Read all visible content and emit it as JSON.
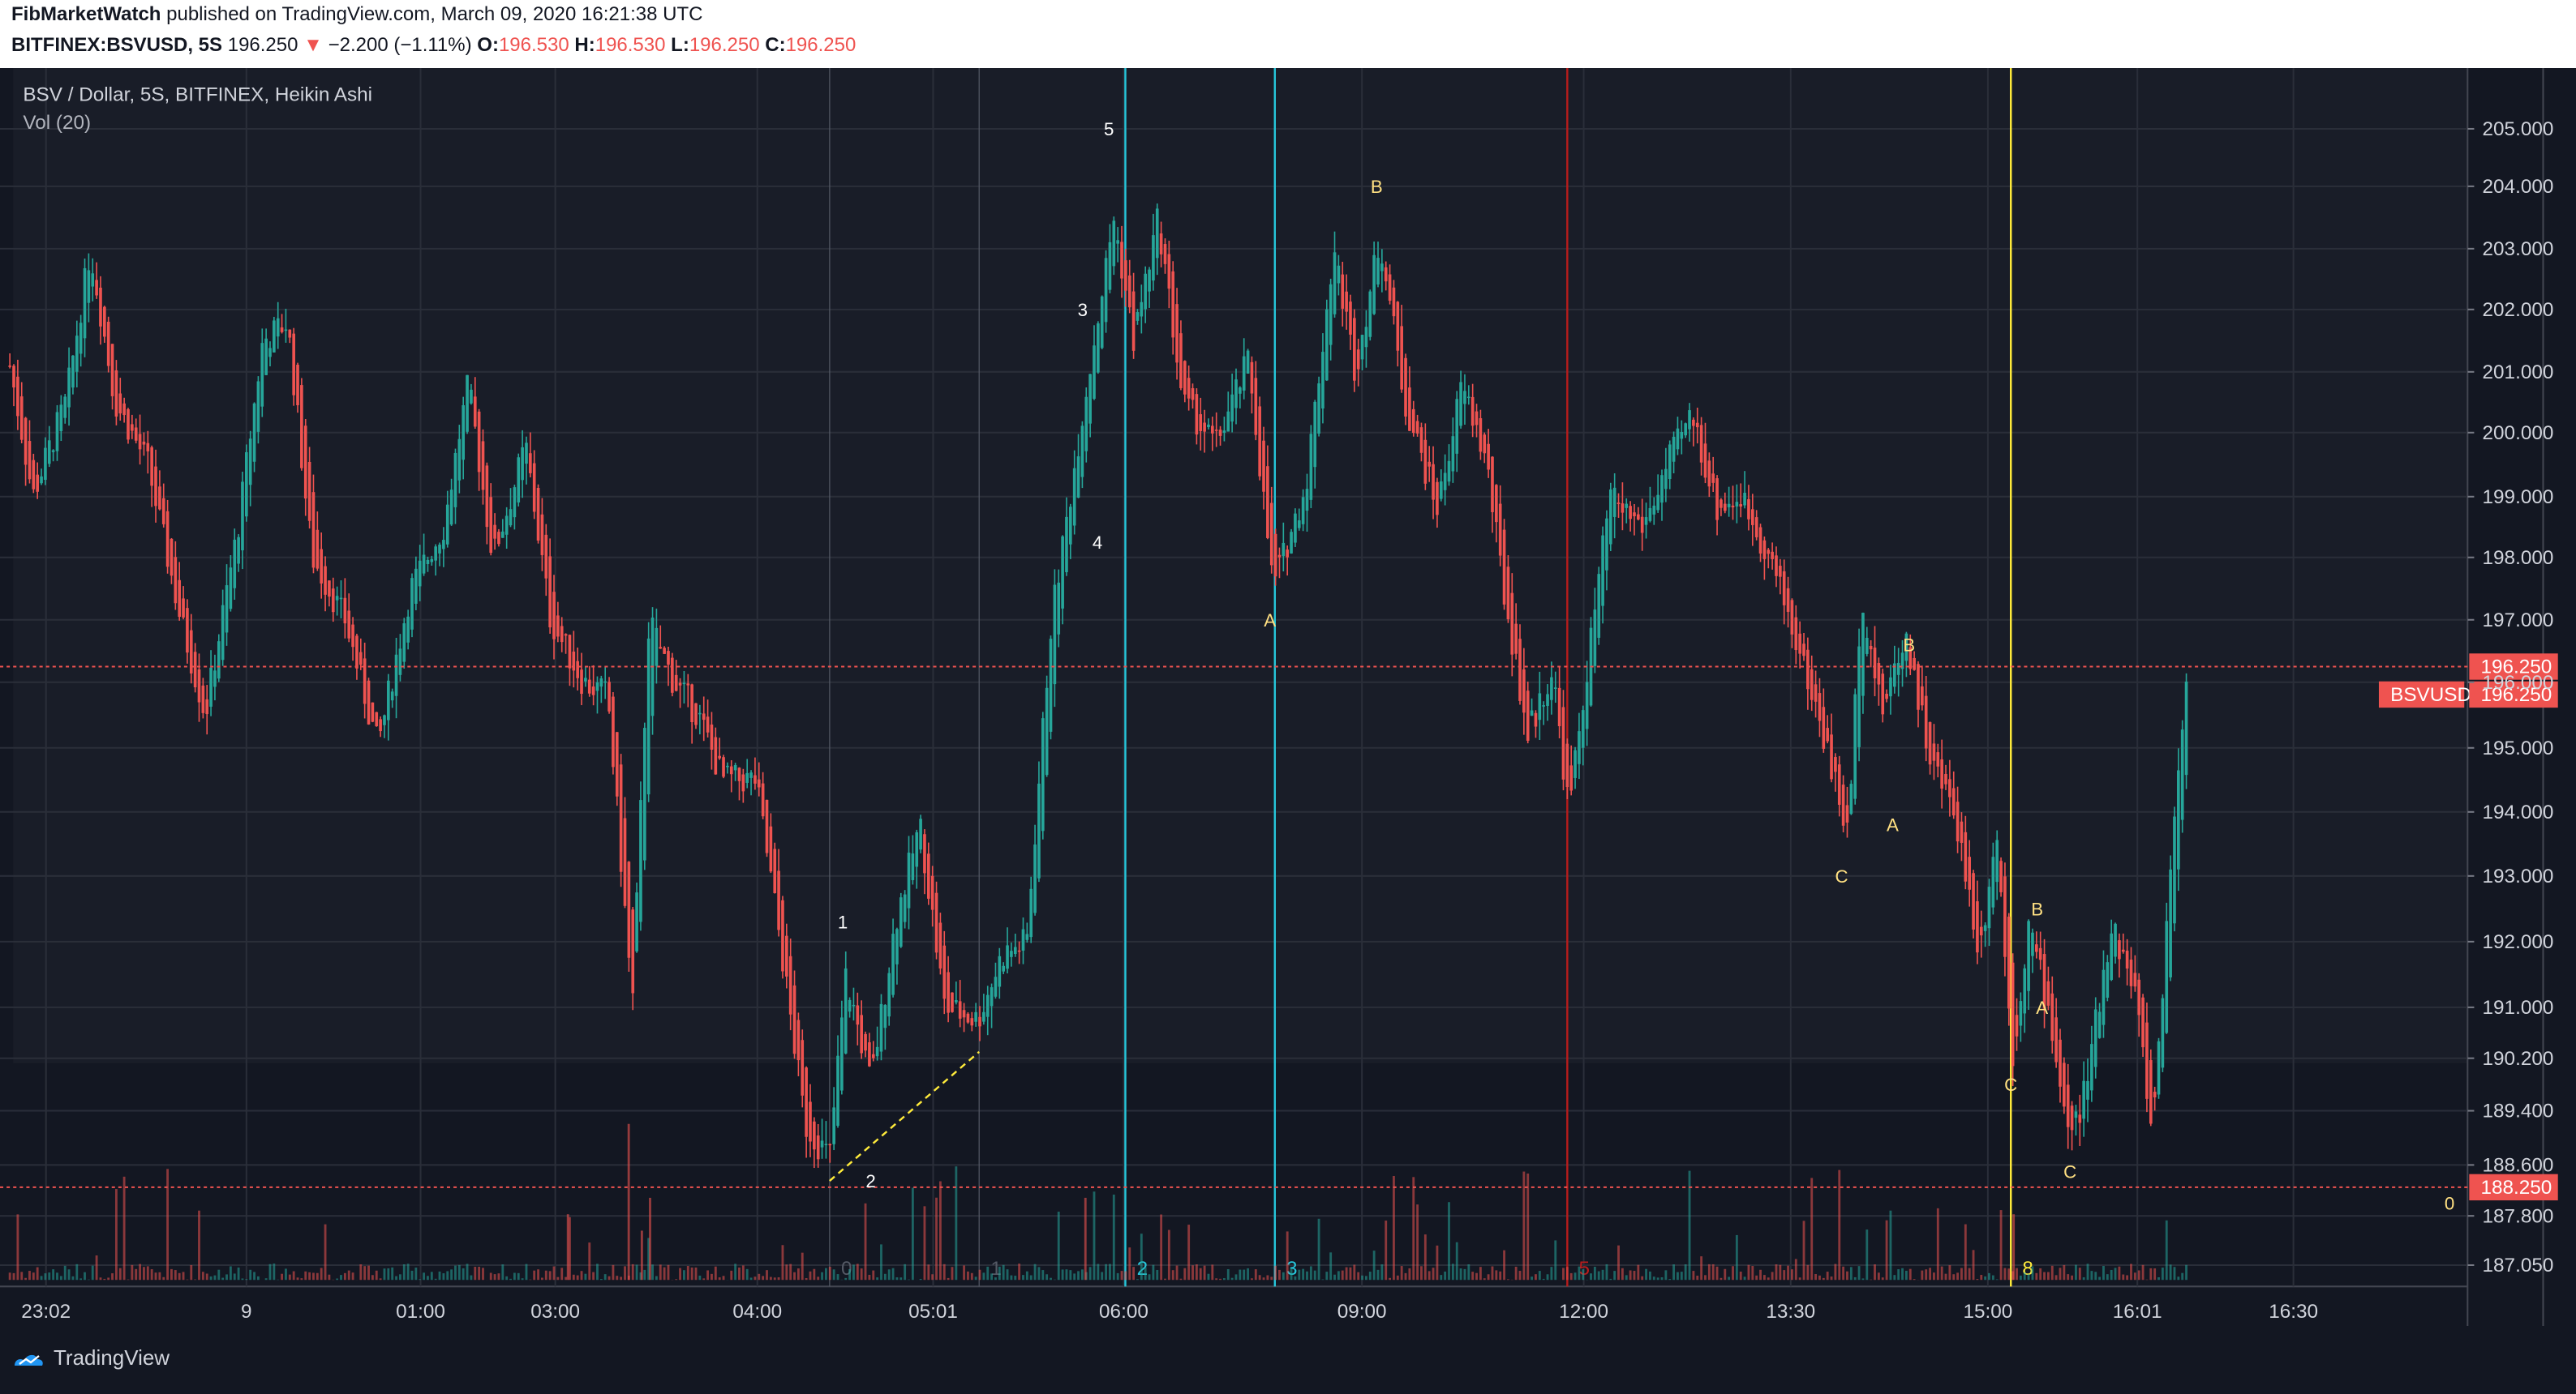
{
  "header": {
    "author": "FibMarketWatch",
    "published": "published on TradingView.com, March 09, 2020 16:21:38 UTC",
    "symbol": "BITFINEX:BSVUSD, 5S",
    "last": "196.250",
    "change": "−2.200 (−1.11%)",
    "o_label": "O:",
    "o_val": "196.530",
    "h_label": "H:",
    "h_val": "196.530",
    "l_label": "L:",
    "l_val": "196.250",
    "c_label": "C:",
    "c_val": "196.250"
  },
  "legend": {
    "title": "BSV / Dollar, 5S, BITFINEX, Heikin Ashi",
    "volume": "Vol (20)"
  },
  "footer": {
    "brand": "TradingView"
  },
  "colors": {
    "background": "#131722",
    "up": "#26a69a",
    "down": "#ef5350",
    "cyan_line": "#26c6da",
    "red_line": "#b71c1c",
    "yellow_line": "#ffeb3b",
    "wave_label": "#ffe082",
    "price_tag": "#ef5350"
  },
  "chart_data": {
    "type": "candlestick",
    "title": "BSV / Dollar, 5S, BITFINEX, Heikin Ashi",
    "ylim": [
      186.8,
      205.6
    ],
    "y_ticks": [
      "205.000",
      "204.000",
      "203.000",
      "202.000",
      "201.000",
      "200.000",
      "199.000",
      "198.000",
      "197.000",
      "196.000",
      "195.000",
      "194.000",
      "193.000",
      "192.000",
      "191.000",
      "190.200",
      "189.400",
      "188.600",
      "187.800",
      "187.050"
    ],
    "x_ticks": [
      "23:02",
      "9",
      "01:00",
      "03:00",
      "04:00",
      "05:01",
      "06:00",
      "09:00",
      "12:00",
      "13:30",
      "15:00",
      "16:01",
      "16:30"
    ],
    "price_path": [
      [
        0,
        202.0
      ],
      [
        20,
        199.0
      ],
      [
        40,
        200.5
      ],
      [
        55,
        203.0
      ],
      [
        70,
        200.5
      ],
      [
        90,
        199.5
      ],
      [
        110,
        197.0
      ],
      [
        125,
        195.5
      ],
      [
        145,
        198.5
      ],
      [
        160,
        201.5
      ],
      [
        175,
        201.8
      ],
      [
        190,
        198.0
      ],
      [
        210,
        197.0
      ],
      [
        230,
        195.0
      ],
      [
        250,
        197.5
      ],
      [
        270,
        198.5
      ],
      [
        285,
        200.8
      ],
      [
        300,
        198.0
      ],
      [
        320,
        199.8
      ],
      [
        335,
        197.0
      ],
      [
        355,
        196.0
      ],
      [
        370,
        195.8
      ],
      [
        385,
        191.0
      ],
      [
        395,
        197.0
      ],
      [
        410,
        196.0
      ],
      [
        425,
        195.5
      ],
      [
        440,
        194.5
      ],
      [
        460,
        194.5
      ],
      [
        475,
        192.0
      ],
      [
        490,
        189.2
      ],
      [
        505,
        188.7
      ],
      [
        515,
        191.5
      ],
      [
        530,
        189.8
      ],
      [
        545,
        192.3
      ],
      [
        560,
        193.8
      ],
      [
        575,
        191.0
      ],
      [
        595,
        190.8
      ],
      [
        610,
        191.8
      ],
      [
        625,
        192.0
      ],
      [
        640,
        197.0
      ],
      [
        660,
        200.5
      ],
      [
        678,
        203.5
      ],
      [
        690,
        201.5
      ],
      [
        705,
        203.5
      ],
      [
        720,
        200.5
      ],
      [
        740,
        199.8
      ],
      [
        760,
        201.2
      ],
      [
        775,
        197.5
      ],
      [
        795,
        199.2
      ],
      [
        812,
        203.0
      ],
      [
        825,
        201.0
      ],
      [
        840,
        203.2
      ],
      [
        855,
        200.5
      ],
      [
        875,
        198.8
      ],
      [
        890,
        200.8
      ],
      [
        905,
        199.5
      ],
      [
        915,
        197.5
      ],
      [
        930,
        195.2
      ],
      [
        945,
        196.2
      ],
      [
        955,
        194.0
      ],
      [
        965,
        196.0
      ],
      [
        980,
        199.0
      ],
      [
        1000,
        198.5
      ],
      [
        1015,
        199.5
      ],
      [
        1030,
        200.3
      ],
      [
        1045,
        198.8
      ],
      [
        1060,
        199.0
      ],
      [
        1080,
        197.8
      ],
      [
        1095,
        196.5
      ],
      [
        1110,
        195.2
      ],
      [
        1125,
        193.6
      ],
      [
        1133,
        197.5
      ],
      [
        1145,
        195.5
      ],
      [
        1160,
        196.8
      ],
      [
        1175,
        194.8
      ],
      [
        1190,
        194.0
      ],
      [
        1205,
        191.8
      ],
      [
        1215,
        193.8
      ],
      [
        1225,
        190.2
      ],
      [
        1235,
        192.3
      ],
      [
        1248,
        190.8
      ],
      [
        1260,
        188.9
      ],
      [
        1270,
        189.8
      ],
      [
        1285,
        192.3
      ],
      [
        1300,
        191.2
      ],
      [
        1310,
        189.0
      ],
      [
        1325,
        194.5
      ],
      [
        1332,
        196.3
      ]
    ],
    "markers": {
      "vertical_lines": [
        {
          "color": "cyan",
          "label": "2",
          "price_label_x": 685
        },
        {
          "color": "cyan",
          "label": "3",
          "price_label_x": 776
        },
        {
          "color": "red",
          "label": "5",
          "price_label_x": 954
        },
        {
          "color": "yellow",
          "label": "8",
          "price_label_x": 1224
        },
        {
          "color": "gray",
          "label": "0",
          "price_label_x": 505
        },
        {
          "color": "gray",
          "label": "1",
          "price_label_x": 596
        }
      ],
      "horizontal_lines": [
        {
          "price": 196.25,
          "label": "196.250"
        },
        {
          "price": 188.25,
          "label": "188.250"
        }
      ],
      "current_price_tag": {
        "symbol": "BSVUSD",
        "value": "196.250"
      }
    },
    "wave_labels": [
      {
        "text": "1",
        "x": 513,
        "price": 192.3,
        "color": "white"
      },
      {
        "text": "2",
        "x": 530,
        "price": 188.35,
        "color": "white"
      },
      {
        "text": "3",
        "x": 659,
        "price": 202.0,
        "color": "white"
      },
      {
        "text": "4",
        "x": 668,
        "price": 198.25,
        "color": "white"
      },
      {
        "text": "5",
        "x": 675,
        "price": 205.0,
        "color": "white"
      },
      {
        "text": "A",
        "x": 773,
        "price": 197.0,
        "color": "yellow"
      },
      {
        "text": "B",
        "x": 838,
        "price": 204.0,
        "color": "yellow"
      },
      {
        "text": "C",
        "x": 1121,
        "price": 193.0,
        "color": "yellow"
      },
      {
        "text": "A",
        "x": 1152,
        "price": 193.8,
        "color": "yellow"
      },
      {
        "text": "B",
        "x": 1162,
        "price": 196.6,
        "color": "yellow"
      },
      {
        "text": "C",
        "x": 1224,
        "price": 189.8,
        "color": "yellow"
      },
      {
        "text": "B",
        "x": 1240,
        "price": 192.5,
        "color": "yellow"
      },
      {
        "text": "A",
        "x": 1243,
        "price": 191.0,
        "color": "yellow"
      },
      {
        "text": "C",
        "x": 1260,
        "price": 188.5,
        "color": "yellow"
      },
      {
        "text": "0",
        "x": 1491,
        "price": 188.0,
        "color": "yellow"
      }
    ]
  }
}
